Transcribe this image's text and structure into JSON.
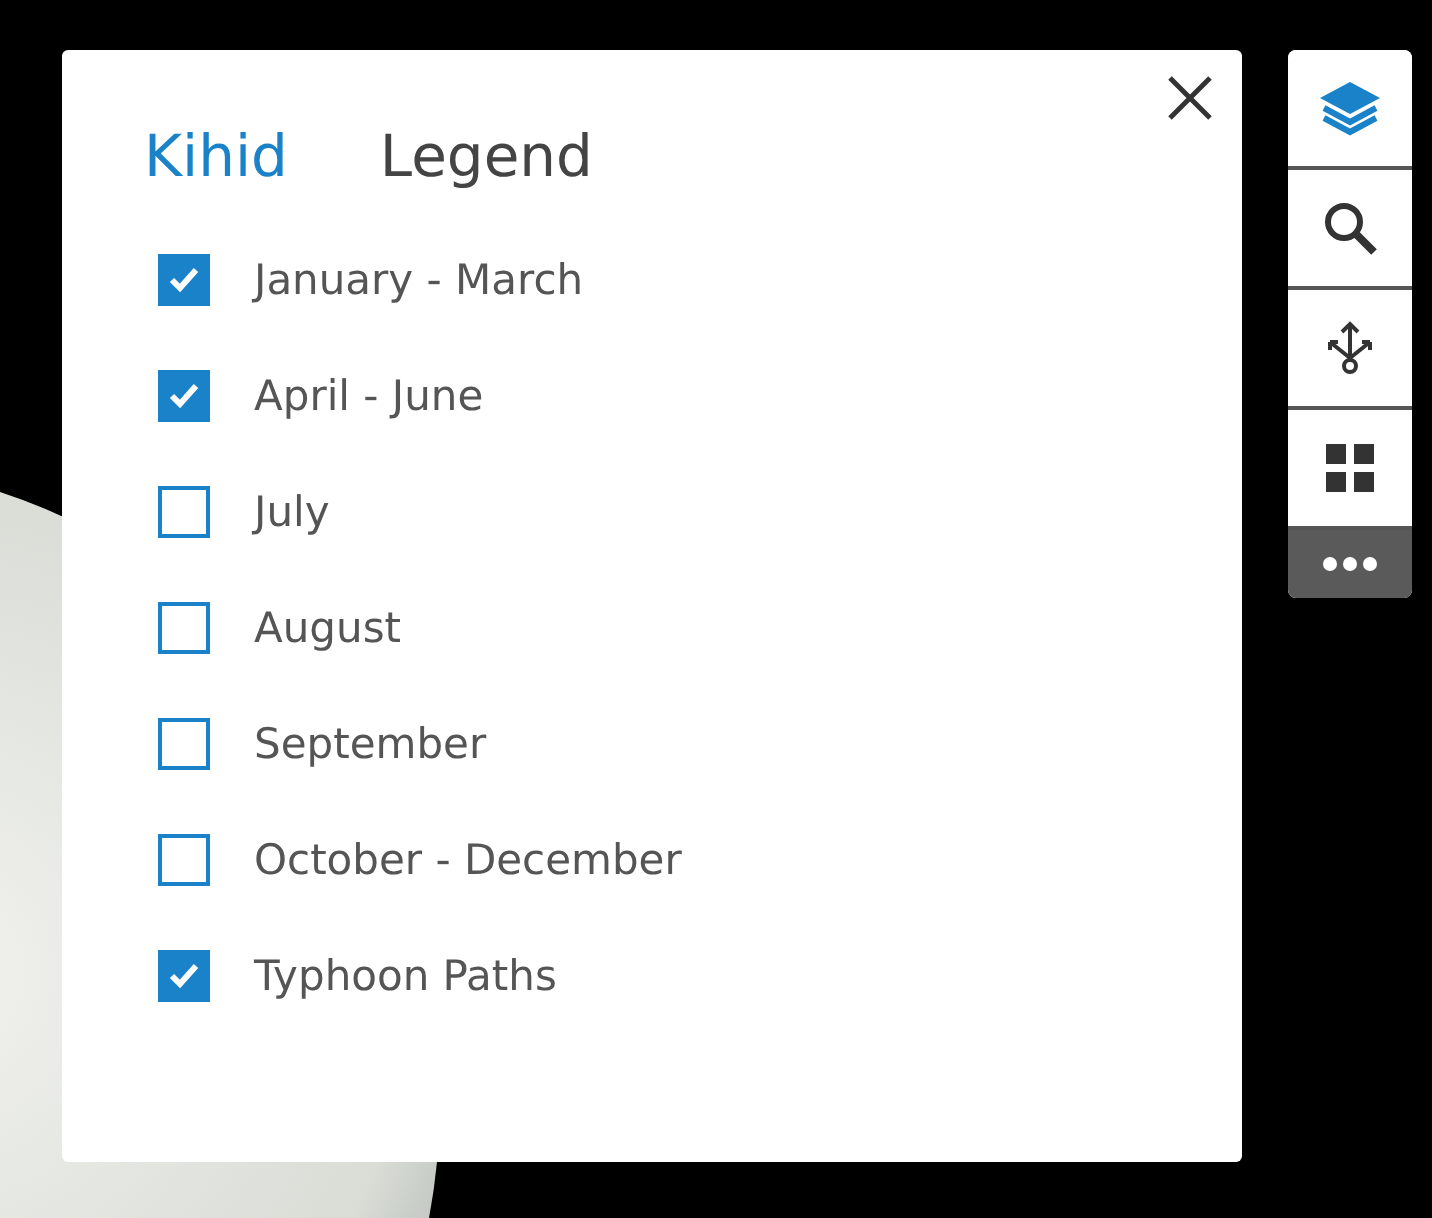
{
  "tabs": [
    {
      "label": "Kihid",
      "selected": true
    },
    {
      "label": "Legend",
      "selected": false
    }
  ],
  "layers": [
    {
      "label": "January - March",
      "checked": true
    },
    {
      "label": "April - June",
      "checked": true
    },
    {
      "label": "July",
      "checked": false
    },
    {
      "label": "August",
      "checked": false
    },
    {
      "label": "September",
      "checked": false
    },
    {
      "label": "October - December",
      "checked": false
    },
    {
      "label": "Typhoon Paths",
      "checked": true
    }
  ],
  "toolbar": [
    {
      "kind": "layers",
      "selected": true
    },
    {
      "kind": "search",
      "selected": false
    },
    {
      "kind": "share",
      "selected": false
    },
    {
      "kind": "basemap",
      "selected": false
    },
    {
      "kind": "more"
    }
  ]
}
